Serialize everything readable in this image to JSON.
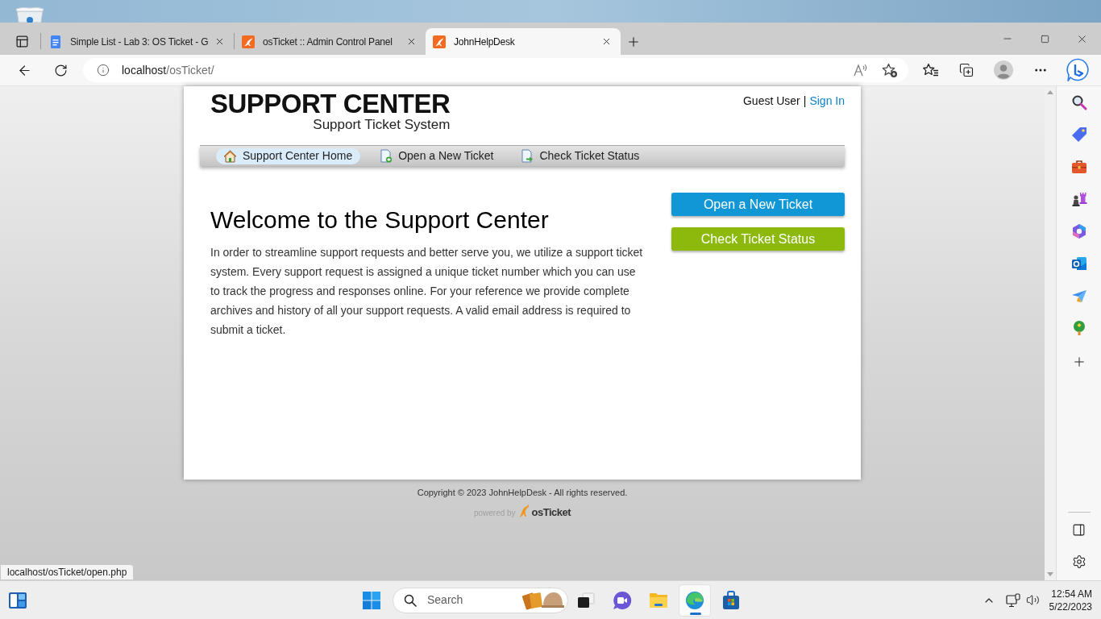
{
  "browser": {
    "tabs": [
      {
        "title": "Simple List - Lab 3: OS Ticket - G",
        "kind": "docs",
        "selected": false
      },
      {
        "title": "osTicket :: Admin Control Panel",
        "kind": "osticket",
        "selected": false
      },
      {
        "title": "JohnHelpDesk",
        "kind": "osticket",
        "selected": true
      }
    ],
    "address": {
      "host": "localhost",
      "path": "/osTicket/"
    },
    "status_url": "localhost/osTicket/open.php"
  },
  "page": {
    "logo": {
      "title": "SUPPORT CENTER",
      "subtitle": "Support Ticket System"
    },
    "account": {
      "user": "Guest User",
      "separator": "|",
      "sign_in": "Sign In"
    },
    "nav": [
      {
        "label": "Support Center Home",
        "kind": "home",
        "selected": true
      },
      {
        "label": "Open a New Ticket",
        "kind": "new-ticket",
        "selected": false
      },
      {
        "label": "Check Ticket Status",
        "kind": "ticket-status",
        "selected": false
      }
    ],
    "heading": "Welcome to the Support Center",
    "intro": "In order to streamline support requests and better serve you, we utilize a support ticket system. Every support request is assigned a unique ticket number which you can use to track the progress and responses online. For your reference we provide complete archives and history of all your support requests. A valid email address is required to submit a ticket.",
    "actions": [
      {
        "label": "Open a New Ticket",
        "color": "#1196d6"
      },
      {
        "label": "Check Ticket Status",
        "color": "#8cb90c"
      }
    ],
    "footer": {
      "copyright": "Copyright © 2023 JohnHelpDesk - All rights reserved.",
      "powered_by": "powered by",
      "brand": "osTicket"
    }
  },
  "taskbar": {
    "search": {
      "placeholder": "Search"
    },
    "apps": [
      {
        "kind": "task-view",
        "selected": false
      },
      {
        "kind": "chat",
        "selected": false
      },
      {
        "kind": "file-explorer",
        "selected": false
      },
      {
        "kind": "edge",
        "selected": true
      },
      {
        "kind": "store",
        "selected": false
      }
    ],
    "time": "12:54 AM",
    "date": "5/22/2023"
  }
}
